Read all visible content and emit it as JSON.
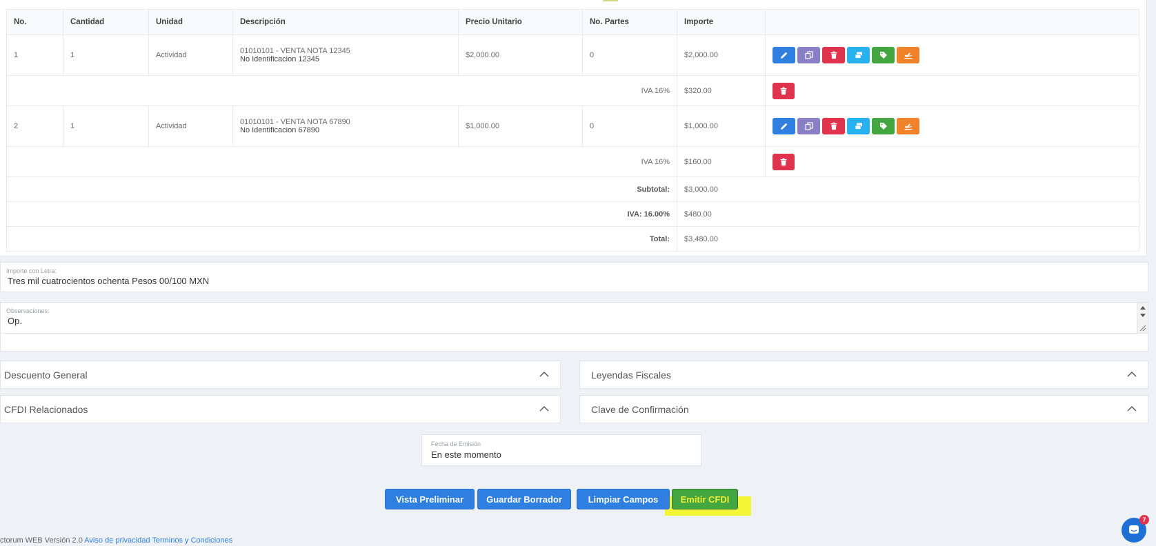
{
  "table": {
    "headers": [
      "No.",
      "Cantidad",
      "Unidad",
      "Descripción",
      "Precio Unitario",
      "No. Partes",
      "Importe"
    ],
    "items": [
      {
        "no": "1",
        "cantidad": "1",
        "unidad": "Actividad",
        "desc1": "01010101 - VENTA NOTA 12345",
        "desc2": "No Identificacion 12345",
        "precio": "$2,000.00",
        "partes": "0",
        "importe": "$2,000.00",
        "tax_label": "IVA 16%",
        "tax_value": "$320.00"
      },
      {
        "no": "2",
        "cantidad": "1",
        "unidad": "Actividad",
        "desc1": "01010101 - VENTA NOTA 67890",
        "desc2": "No Identificacion 67890",
        "precio": "$1,000.00",
        "partes": "0",
        "importe": "$1,000.00",
        "tax_label": "IVA 16%",
        "tax_value": "$160.00"
      }
    ],
    "totals": {
      "subtotal_label": "Subtotal:",
      "subtotal_value": "$3,000.00",
      "iva_label": "IVA: 16.00%",
      "iva_value": "$480.00",
      "total_label": "Total:",
      "total_value": "$3,480.00"
    }
  },
  "importe_letra": {
    "label": "Importe con Letra:",
    "value": "Tres mil cuatrocientos ochenta Pesos 00/100  MXN"
  },
  "observaciones": {
    "label": "Observaciones:",
    "value": "Op."
  },
  "accordions": {
    "descuento": "Descuento General",
    "leyendas": "Leyendas Fiscales",
    "cfdi_rel": "CFDI Relacionados",
    "clave": "Clave de Confirmación"
  },
  "fecha": {
    "label": "Fecha de Emisión",
    "value": "En este momento"
  },
  "buttons": {
    "vista": "Vista Preliminar",
    "guardar": "Guardar Borrador",
    "limpiar": "Limpiar Campos",
    "emitir": "Emitir CFDI"
  },
  "footer": {
    "version": "ctorum WEB Versión 2.0 ",
    "privacy": "Aviso de privacidad",
    "terms": "Terminos y Condiciones"
  },
  "chat": {
    "badge": "7"
  },
  "colors": {
    "edit": "#2f7fe0",
    "copy": "#8a7fc6",
    "delete": "#e0334d",
    "money": "#27b1ee",
    "tag": "#44a640",
    "plane": "#f0822c",
    "emit_text": "#f2ef32",
    "highlight": "#f5f537"
  }
}
